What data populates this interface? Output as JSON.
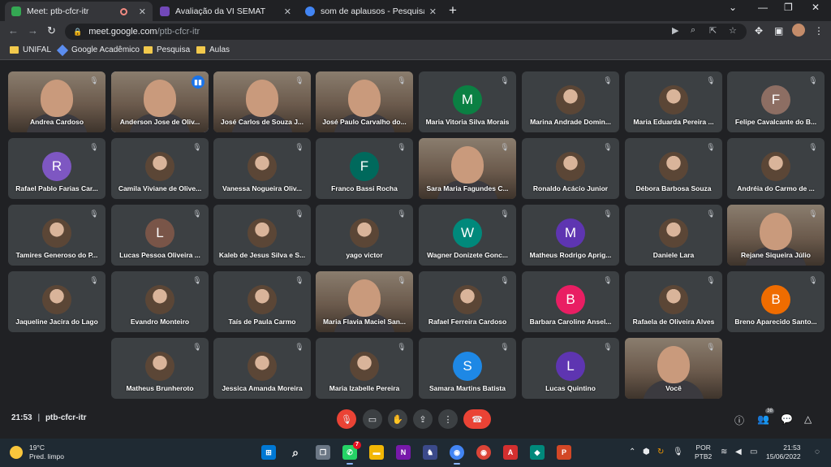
{
  "browser": {
    "tabs": [
      {
        "title": "Meet: ptb-cfcr-itr",
        "active": true,
        "favicon_color": "#34a853"
      },
      {
        "title": "Avaliação da VI SEMAT",
        "active": false,
        "favicon_color": "#7248b9"
      },
      {
        "title": "som de aplausos - Pesquisa Goo",
        "active": false,
        "favicon_color": "#4285f4"
      }
    ],
    "close_glyph": "✕",
    "new_tab_glyph": "+",
    "window_controls": [
      "⌄",
      "—",
      "❐",
      "✕"
    ],
    "address": {
      "host": "meet.google.com",
      "path": "/ptb-cfcr-itr"
    },
    "bookmarks": [
      "UNIFAL",
      "Google Acadêmico",
      "Pesquisa",
      "Aulas"
    ]
  },
  "meet": {
    "participants": [
      {
        "name": "Andrea Cardoso",
        "type": "video"
      },
      {
        "name": "Anderson Jose de Oliv...",
        "type": "video",
        "speaking": true
      },
      {
        "name": "José Carlos de Souza J...",
        "type": "video"
      },
      {
        "name": "José Paulo Carvalho do...",
        "type": "video"
      },
      {
        "name": "Maria Vitoria Silva Morais",
        "type": "initial",
        "initial": "M",
        "color": "#0b8043"
      },
      {
        "name": "Marina Andrade Domin...",
        "type": "photo"
      },
      {
        "name": "Maria Eduarda Pereira ...",
        "type": "photo"
      },
      {
        "name": "Felipe Cavalcante do B...",
        "type": "initial",
        "initial": "F",
        "color": "#8d6e63"
      },
      {
        "name": "Rafael Pablo Farias Car...",
        "type": "initial",
        "initial": "R",
        "color": "#7e57c2"
      },
      {
        "name": "Camila Viviane de Olive...",
        "type": "photo"
      },
      {
        "name": "Vanessa Nogueira Oliv...",
        "type": "photo"
      },
      {
        "name": "Franco Bassi Rocha",
        "type": "initial",
        "initial": "F",
        "color": "#00695c"
      },
      {
        "name": "Sara Maria Fagundes C...",
        "type": "video"
      },
      {
        "name": "Ronaldo Acácio Junior",
        "type": "photo"
      },
      {
        "name": "Débora Barbosa Souza",
        "type": "photo"
      },
      {
        "name": "Andréia do Carmo de ...",
        "type": "photo"
      },
      {
        "name": "Tamires Generoso do P...",
        "type": "photo"
      },
      {
        "name": "Lucas Pessoa Oliveira ...",
        "type": "initial",
        "initial": "L",
        "color": "#795548"
      },
      {
        "name": "Kaleb de Jesus Silva e S...",
        "type": "photo"
      },
      {
        "name": "yago victor",
        "type": "photo"
      },
      {
        "name": "Wagner Donizete Gonc...",
        "type": "initial",
        "initial": "W",
        "color": "#00897b"
      },
      {
        "name": "Matheus Rodrigo Aprig...",
        "type": "initial",
        "initial": "M",
        "color": "#5e35b1"
      },
      {
        "name": "Daniele Lara",
        "type": "photo"
      },
      {
        "name": "Rejane Siqueira Júlio",
        "type": "video"
      },
      {
        "name": "Jaqueline Jacira do Lago",
        "type": "photo"
      },
      {
        "name": "Evandro Monteiro",
        "type": "photo"
      },
      {
        "name": "Taís de Paula Carmo",
        "type": "photo"
      },
      {
        "name": "Maria Flavia Maciel San...",
        "type": "video"
      },
      {
        "name": "Rafael Ferreira Cardoso",
        "type": "photo"
      },
      {
        "name": "Barbara Caroline Ansel...",
        "type": "initial",
        "initial": "B",
        "color": "#e91e63"
      },
      {
        "name": "Rafaela de Oliveira Alves",
        "type": "photo"
      },
      {
        "name": "Breno Aparecido Santo...",
        "type": "initial",
        "initial": "B",
        "color": "#ef6c00"
      },
      {
        "name": "Matheus Brunheroto",
        "type": "photo"
      },
      {
        "name": "Jessica Amanda Moreira",
        "type": "photo"
      },
      {
        "name": "Maria Izabelle Pereira",
        "type": "photo"
      },
      {
        "name": "Samara Martins Batista",
        "type": "initial",
        "initial": "S",
        "color": "#1e88e5"
      },
      {
        "name": "Lucas Quintino",
        "type": "initial",
        "initial": "L",
        "color": "#5e35b1"
      },
      {
        "name": "Você",
        "type": "video"
      }
    ],
    "muted_glyph": "🎙",
    "speaking_glyph": "▮▮",
    "time": "21:53",
    "separator": "|",
    "meeting_code": "ptb-cfcr-itr",
    "people_count": "38",
    "controls": {
      "mic": "🎙",
      "camera": "▭",
      "hand": "✋",
      "present": "⇪",
      "more": "⋮",
      "end": "☎"
    },
    "right_icons": {
      "info": "ⓘ",
      "people": "👥",
      "chat": "💬",
      "activities": "△"
    }
  },
  "taskbar": {
    "weather": {
      "temp": "19°C",
      "desc": "Pred. limpo"
    },
    "whatsapp_badge": "7",
    "language": {
      "line1": "POR",
      "line2": "PTB2"
    },
    "clock": {
      "time": "21:53",
      "date": "15/06/2022"
    }
  }
}
